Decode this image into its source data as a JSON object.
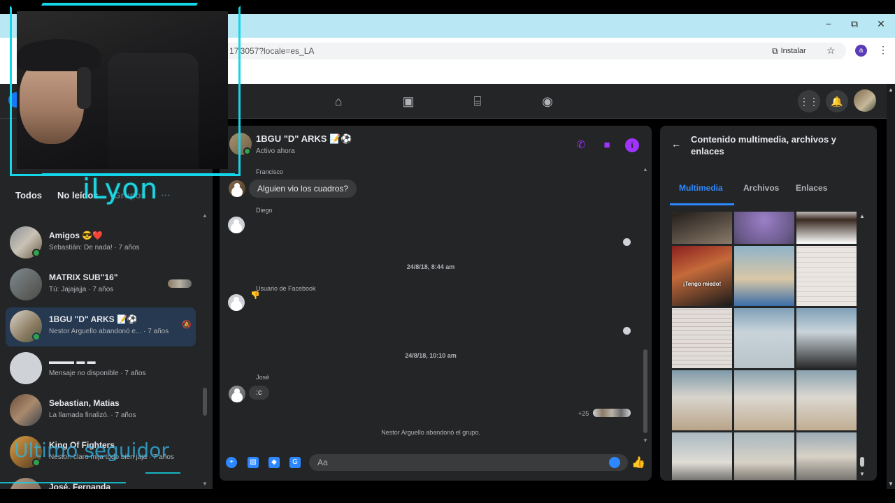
{
  "browser": {
    "url": "17'3057?locale=es_LA",
    "install_label": "Instalar",
    "profile_initial": "a",
    "minimize": "−",
    "restore": "⧉",
    "close": "✕"
  },
  "sidebar": {
    "filters": [
      "Todos",
      "No leídos",
      "Grupos",
      "···"
    ],
    "chats": [
      {
        "name": "Amigos 😎❤️",
        "preview": "Sebastián: De nada! · 7 años",
        "online": true
      },
      {
        "name": "MATRIX SUB\"16\"",
        "preview": "Tú: Jajajajja · 7 años",
        "online": false
      },
      {
        "name": "1BGU \"D\" ARKS 📝⚽",
        "preview": "Nestor Arguello abandonó e... · 7 años",
        "online": true,
        "active": true
      },
      {
        "name": "▬▬▬ ▬ ▬",
        "preview": "Mensaje no disponible · 7 años",
        "online": false
      },
      {
        "name": "Sebastian, Matias",
        "preview": "La llamada finalizó. · 7 años",
        "online": false
      },
      {
        "name": "King Of Fighters",
        "preview": "Nestor: claro mija todo bien jaja · 7 años",
        "online": true
      },
      {
        "name": "José, Fernanda",
        "preview": "",
        "online": false
      }
    ]
  },
  "conversation": {
    "title": "1BGU \"D\" ARKS 📝⚽",
    "status": "Activo ahora",
    "messages": [
      {
        "sender": "Francisco",
        "text": "Alguien vio los cuadros?"
      },
      {
        "sender": "Diego",
        "text": ""
      },
      {
        "sender": "Usuario de Facebook",
        "text": "👎"
      },
      {
        "sender": "José",
        "text": ":c"
      }
    ],
    "dates": [
      "24/8/18, 8:44 am",
      "24/8/18, 10:10 am"
    ],
    "seen_count": "+25",
    "system_message": "Nestor Arguello abandonó el grupo.",
    "input_placeholder": "Aa"
  },
  "right_panel": {
    "title": "Contenido multimedia, archivos y enlaces",
    "tabs": [
      "Multimedia",
      "Archivos",
      "Enlaces"
    ],
    "meme_caption": "¡Tengo miedo!"
  },
  "overlay": {
    "streamer_name": "iLyon",
    "follower_label": "Ultimo seguidor"
  },
  "colors": {
    "accent": "#2d88ff",
    "purple": "#a033ff",
    "overlay_cyan": "#13d6e8"
  }
}
